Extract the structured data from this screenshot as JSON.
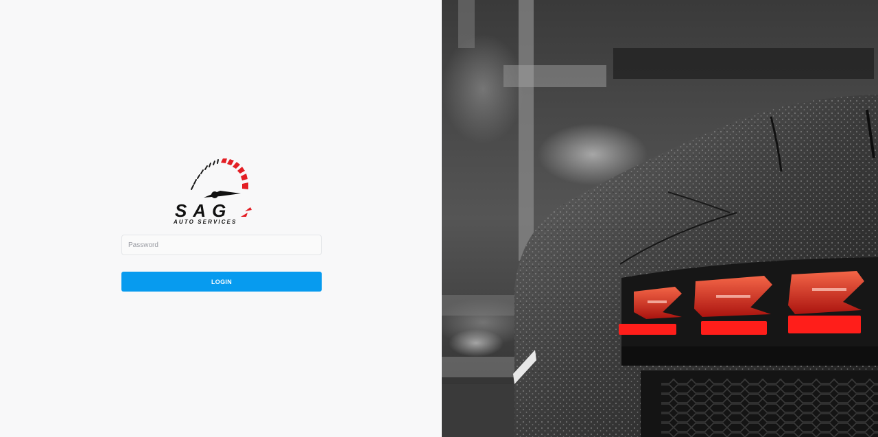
{
  "login": {
    "logo": {
      "brand_text": "SAG",
      "tagline": "AUTO SERVICES"
    },
    "password": {
      "placeholder": "Password",
      "value": ""
    },
    "button_label": "LOGIN"
  },
  "background": {
    "subject": "car-taillight-photo"
  },
  "colors": {
    "accent": "#079bef",
    "logo_red": "#e31e24",
    "page_bg": "#f8f8f9"
  }
}
